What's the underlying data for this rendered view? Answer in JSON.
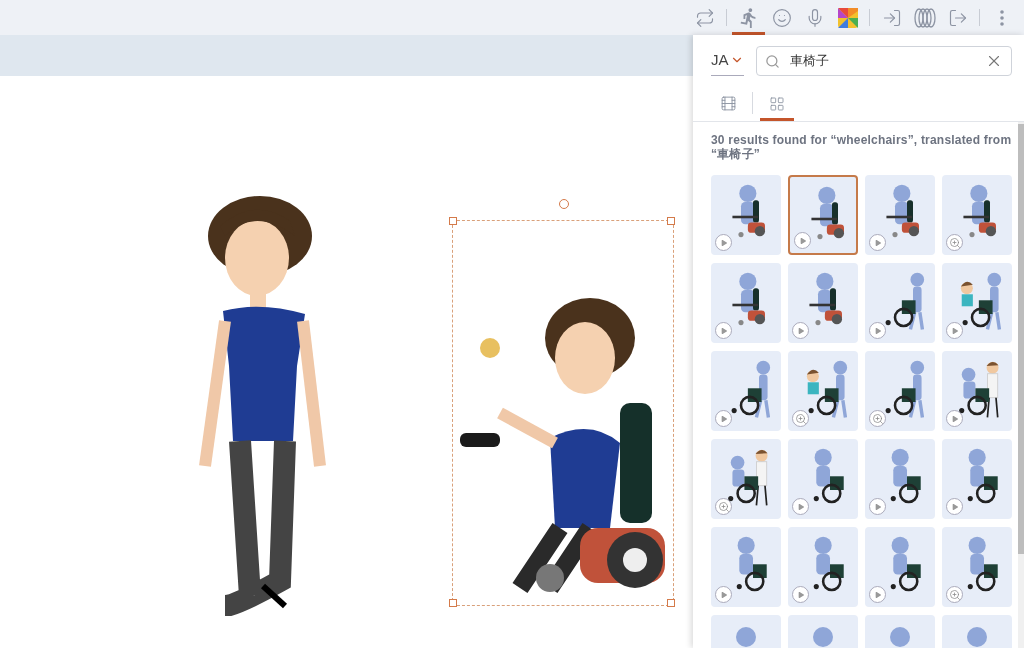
{
  "toolbar": {
    "groups": [
      {
        "items": [
          {
            "kind": "swap",
            "selected": false
          }
        ]
      },
      {
        "items": [
          {
            "kind": "actions",
            "selected": true
          },
          {
            "kind": "expressions",
            "selected": false
          },
          {
            "kind": "voice",
            "selected": false
          },
          {
            "kind": "colors",
            "selected": false
          }
        ]
      },
      {
        "items": [
          {
            "kind": "enter",
            "selected": false
          },
          {
            "kind": "motion",
            "selected": false
          },
          {
            "kind": "exit",
            "selected": false
          }
        ]
      },
      {
        "items": [
          {
            "kind": "more",
            "selected": false
          }
        ]
      }
    ]
  },
  "canvas": {
    "characters": [
      {
        "kind": "walking",
        "selected": false
      },
      {
        "kind": "powerchair",
        "selected": true
      }
    ]
  },
  "panel": {
    "language": "JA",
    "search": {
      "value": "車椅子"
    },
    "view_tabs": [
      {
        "kind": "scenes",
        "selected": false
      },
      {
        "kind": "grid",
        "selected": true
      }
    ],
    "results_text": "30 results found for “wheelchairs”, translated from “車椅子”",
    "results": [
      {
        "kind": "powerchair",
        "badge": {
          "kind": "play"
        },
        "selected": false
      },
      {
        "kind": "powerchair",
        "badge": {
          "kind": "play"
        },
        "selected": true
      },
      {
        "kind": "powerchair",
        "badge": {
          "kind": "play"
        },
        "selected": false
      },
      {
        "kind": "powerchair",
        "badge": {
          "kind": "zoom"
        },
        "selected": false
      },
      {
        "kind": "powerchair",
        "badge": {
          "kind": "play"
        },
        "selected": false
      },
      {
        "kind": "powerchair",
        "badge": {
          "kind": "play"
        },
        "selected": false
      },
      {
        "kind": "pushed",
        "badge": {
          "kind": "play"
        },
        "selected": false
      },
      {
        "kind": "pushed_person",
        "badge": {
          "kind": "play"
        },
        "selected": false
      },
      {
        "kind": "pushed",
        "badge": {
          "kind": "play"
        },
        "selected": false
      },
      {
        "kind": "pushed_person",
        "badge": {
          "kind": "zoom"
        },
        "selected": false
      },
      {
        "kind": "pushed",
        "badge": {
          "kind": "zoom"
        },
        "selected": false
      },
      {
        "kind": "doctor",
        "badge": {
          "kind": "play"
        },
        "selected": false
      },
      {
        "kind": "doctor",
        "badge": {
          "kind": "zoom"
        },
        "selected": false
      },
      {
        "kind": "manual",
        "badge": {
          "kind": "play"
        },
        "selected": false
      },
      {
        "kind": "manual",
        "badge": {
          "kind": "play"
        },
        "selected": false
      },
      {
        "kind": "manual",
        "badge": {
          "kind": "play"
        },
        "selected": false
      },
      {
        "kind": "manual",
        "badge": {
          "kind": "play"
        },
        "selected": false
      },
      {
        "kind": "manual",
        "badge": {
          "kind": "play"
        },
        "selected": false
      },
      {
        "kind": "manual",
        "badge": {
          "kind": "play"
        },
        "selected": false
      },
      {
        "kind": "manual",
        "badge": {
          "kind": "zoom"
        },
        "selected": false
      },
      {
        "kind": "partial",
        "selected": false
      },
      {
        "kind": "partial",
        "selected": false
      },
      {
        "kind": "partial",
        "selected": false
      },
      {
        "kind": "partial",
        "selected": false
      }
    ]
  }
}
